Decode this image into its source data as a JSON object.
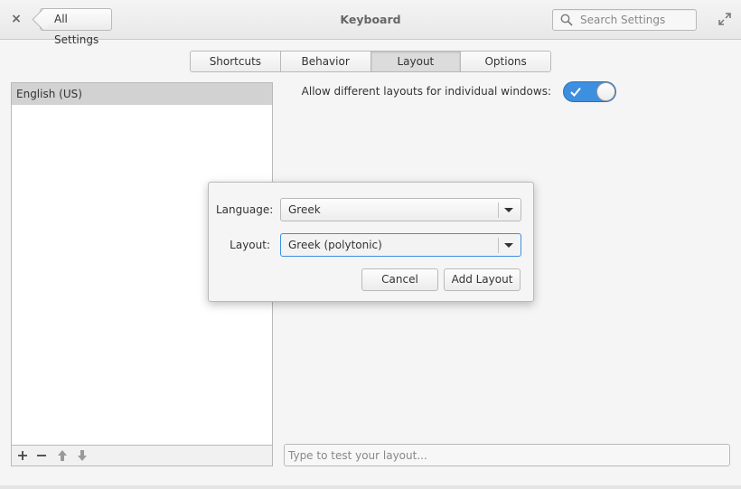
{
  "header": {
    "close_glyph": "×",
    "back_label": "All Settings",
    "title": "Keyboard",
    "search_placeholder": "Search Settings"
  },
  "tabs": [
    {
      "label": "Shortcuts"
    },
    {
      "label": "Behavior"
    },
    {
      "label": "Layout",
      "active": true
    },
    {
      "label": "Options"
    }
  ],
  "layouts": {
    "items": [
      "English (US)"
    ],
    "toolbar": {
      "add": "+",
      "remove": "−"
    }
  },
  "switch_row": {
    "label": "Allow different layouts for individual windows:",
    "enabled": true
  },
  "test_placeholder": "Type to test your layout...",
  "dialog": {
    "language_label": "Language:",
    "language_value": "Greek",
    "layout_label": "Layout:",
    "layout_value": "Greek (polytonic)",
    "cancel_label": "Cancel",
    "add_label": "Add Layout"
  },
  "colors": {
    "accent": "#3d8fe0",
    "selected_row": "#d2d2d2"
  },
  "icons": [
    "close-icon",
    "back-arrow",
    "search-icon",
    "maximize-icon",
    "add-icon",
    "remove-icon",
    "move-up-icon",
    "move-down-icon",
    "check-icon",
    "chevron-down-icon"
  ]
}
